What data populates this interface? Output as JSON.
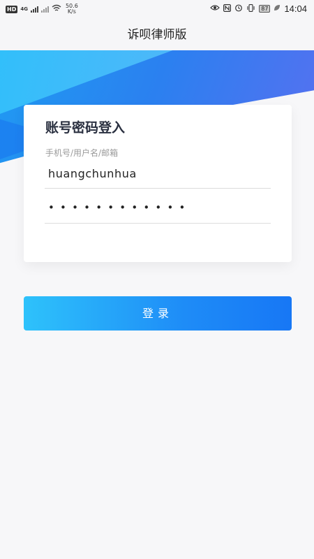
{
  "status_bar": {
    "hd": "HD",
    "network_4g": "4G",
    "speed_value": "50.6",
    "speed_unit": "K/s",
    "battery": "87",
    "time": "14:04"
  },
  "app": {
    "title": "诉呗律师版"
  },
  "login": {
    "heading": "账号密码登入",
    "username_label": "手机号/用户名/邮箱",
    "username_value": "huangchunhua",
    "password_masked": "••••••••••••",
    "submit_label": "登录"
  },
  "colors": {
    "banner_start": "#1f9bf2",
    "banner_end": "#5d6ef0",
    "button_start": "#2ec2fb",
    "button_end": "#1777f5"
  },
  "icons": [
    "hd-icon",
    "signal-icon",
    "wifi-icon",
    "eye-icon",
    "nfc-icon",
    "alarm-icon",
    "vibrate-icon",
    "battery-icon",
    "leaf-icon"
  ]
}
